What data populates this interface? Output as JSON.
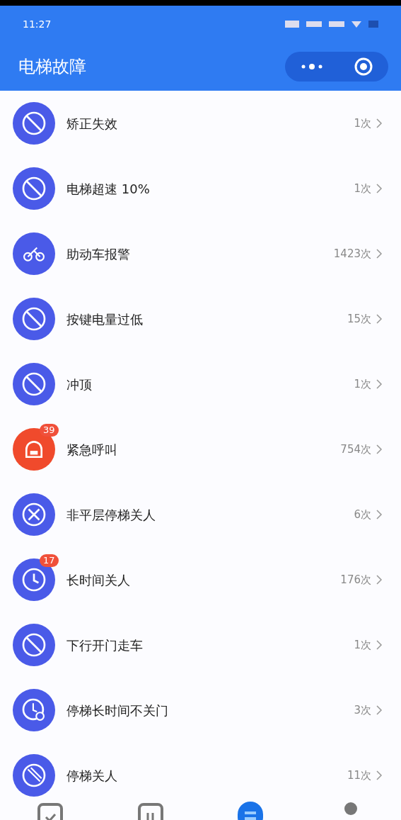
{
  "status_bar": {
    "time": "11:27"
  },
  "header": {
    "title": "电梯故障"
  },
  "items": [
    {
      "kind": "ban",
      "label": "矫正失效",
      "count": "1次",
      "color": "#4a5ae8"
    },
    {
      "kind": "ban",
      "label": "电梯超速 10%",
      "count": "1次",
      "color": "#4a5ae8"
    },
    {
      "kind": "moped",
      "label": "助动车报警",
      "count": "1423次",
      "color": "#4a5ae8"
    },
    {
      "kind": "ban",
      "label": "按键电量过低",
      "count": "15次",
      "color": "#4a5ae8"
    },
    {
      "kind": "ban",
      "label": "冲顶",
      "count": "1次",
      "color": "#4a5ae8"
    },
    {
      "kind": "alarm",
      "label": "紧急呼叫",
      "count": "754次",
      "color": "#f04a2c",
      "badge": "39"
    },
    {
      "kind": "cross",
      "label": "非平层停梯关人",
      "count": "6次",
      "color": "#4a5ae8"
    },
    {
      "kind": "clock",
      "label": "长时间关人",
      "count": "176次",
      "color": "#4a5ae8",
      "badge": "17"
    },
    {
      "kind": "ban",
      "label": "下行开门走车",
      "count": "1次",
      "color": "#4a5ae8"
    },
    {
      "kind": "clocklock",
      "label": "停梯长时间不关门",
      "count": "3次",
      "color": "#4a5ae8"
    },
    {
      "kind": "slash",
      "label": "停梯关人",
      "count": "11次",
      "color": "#4a5ae8"
    }
  ],
  "tabs": [
    {
      "kind": "clipboard",
      "selected": false
    },
    {
      "kind": "calendar",
      "selected": false
    },
    {
      "kind": "list",
      "selected": true
    },
    {
      "kind": "person",
      "selected": false
    }
  ]
}
